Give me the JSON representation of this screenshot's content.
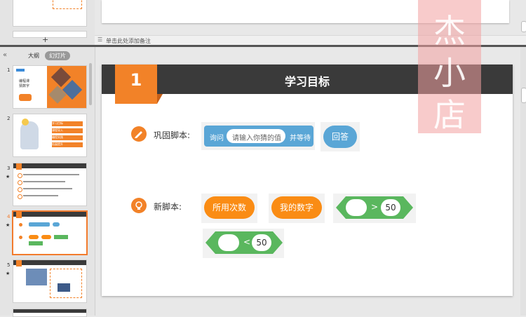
{
  "notes_placeholder": "单击此处添加备注",
  "outline_tab": "大纲",
  "slides_tab": "幻灯片",
  "thumbnails": [
    {
      "number": "1",
      "mark": ""
    },
    {
      "number": "2",
      "mark": ""
    },
    {
      "number": "3",
      "mark": "★"
    },
    {
      "number": "4",
      "mark": "★"
    },
    {
      "number": "5",
      "mark": "★"
    }
  ],
  "thumb1_text": [
    "编程课",
    "猜数字"
  ],
  "thumb2_items": [
    "学习目标",
    "课程导入",
    "编程实践",
    "拓展提升"
  ],
  "slide": {
    "number": "1",
    "title": "学习目标",
    "row1_label": "巩固脚本:",
    "ask_block": {
      "prefix": "询问",
      "input": "请输入你猜的值",
      "suffix": "并等待"
    },
    "answer_block": "回答",
    "row2_label": "新脚本:",
    "var_blocks": [
      "所用次数",
      "我的数字"
    ],
    "gt_block": {
      "op": ">",
      "value": "50"
    },
    "lt_block": {
      "op": "<",
      "value": "50"
    }
  },
  "watermark_chars": [
    "杰",
    "小",
    "店"
  ],
  "colors": {
    "accent": "#f28228",
    "banner": "#3a3a3a",
    "scratch_blue": "#5aa6d6",
    "scratch_green": "#5ab75e",
    "scratch_orange": "#fa8c14"
  }
}
